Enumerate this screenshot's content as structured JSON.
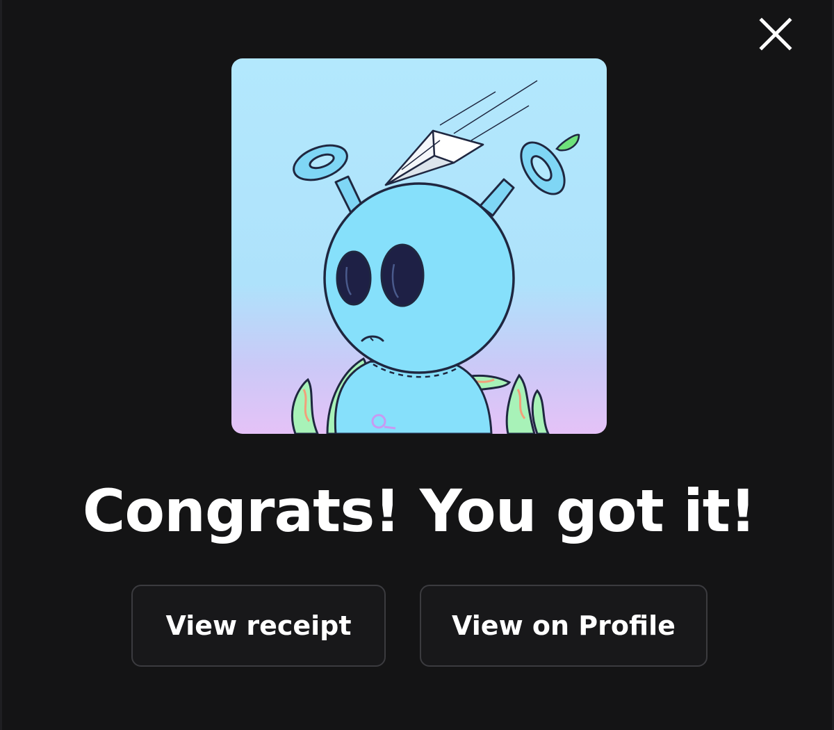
{
  "modal": {
    "close_icon": "close-icon",
    "image": {
      "subject": "blue alien character with antenna rings, paper airplane and tentacles",
      "colors": {
        "background_top": "#b3e8fd",
        "background_bottom": "#e5c2f7",
        "body": "#86e0fb",
        "outline": "#1f2740",
        "tentacle": "#a8f2b8"
      }
    },
    "headline": "Congrats! You got it!",
    "buttons": {
      "receipt_label": "View receipt",
      "profile_label": "View on Profile"
    }
  },
  "theme": {
    "background": "#141415",
    "button_border": "#3b3b3f",
    "text": "#ffffff"
  }
}
